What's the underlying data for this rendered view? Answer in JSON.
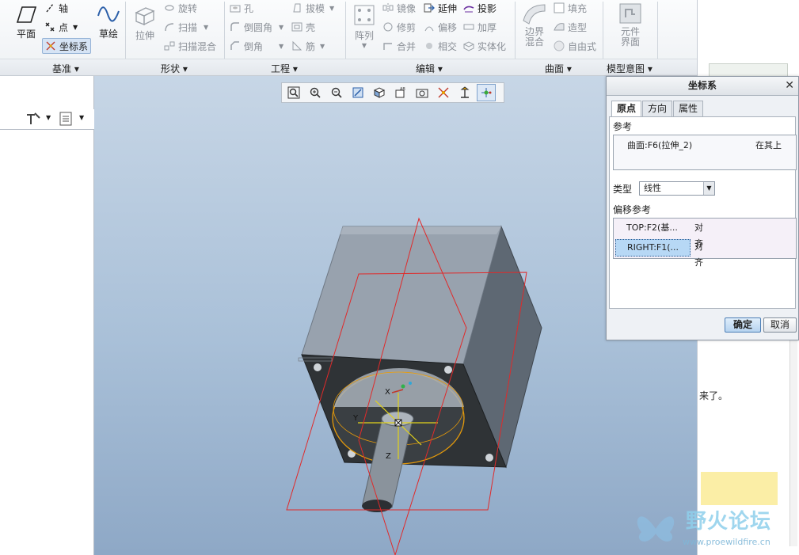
{
  "ribbon": {
    "groups": [
      "基准",
      "形状",
      "工程",
      "编辑",
      "曲面",
      "模型意图"
    ],
    "datum": {
      "plane": "平面",
      "axis": "轴",
      "point": "点",
      "csys": "坐标系",
      "sketch": "草绘"
    },
    "shape": {
      "extrude": "拉伸",
      "revolve": "旋转",
      "sweep": "扫描",
      "swept_blend": "扫描混合"
    },
    "engineering": {
      "hole": "孔",
      "round": "倒圆角",
      "chamfer": "倒角",
      "draft": "拔模",
      "shell": "壳",
      "rib": "筋"
    },
    "editing": {
      "pattern": "阵列",
      "mirror": "镜像",
      "trim": "修剪",
      "merge": "合并",
      "extend": "延伸",
      "offset": "偏移",
      "intersect": "相交",
      "project": "投影",
      "thicken": "加厚",
      "solidify": "实体化"
    },
    "surfaces": {
      "boundary_blend": [
        "边界",
        "混合"
      ],
      "fill": "填充",
      "style": "造型",
      "freestyle": "自由式"
    },
    "model_intent": {
      "component_interface": [
        "元件",
        "界面"
      ]
    }
  },
  "dialog": {
    "title": "坐标系",
    "tabs": [
      "原点",
      "方向",
      "属性"
    ],
    "references_label": "参考",
    "reference": {
      "item": "曲面:F6(拉伸_2)",
      "constraint": "在其上"
    },
    "type_label": "类型",
    "type_value": "线性",
    "offset_label": "偏移参考",
    "offset_refs": [
      {
        "ref": "TOP:F2(基...",
        "mode": "对齐"
      },
      {
        "ref": "RIGHT:F1(...",
        "mode": "对齐"
      }
    ],
    "ok": "确定",
    "cancel": "取消"
  },
  "model": {
    "axis_labels": [
      "X",
      "Y",
      "Z"
    ]
  },
  "side_text": "来了。",
  "watermark": {
    "title": "野火论坛",
    "url": "www.proewildfire.cn"
  },
  "colors": {
    "accent": "#3a7dd0",
    "viewport_top": "#c7d6e6",
    "viewport_bottom": "#8ea8c6",
    "datum_plane": "#e02a2a"
  }
}
